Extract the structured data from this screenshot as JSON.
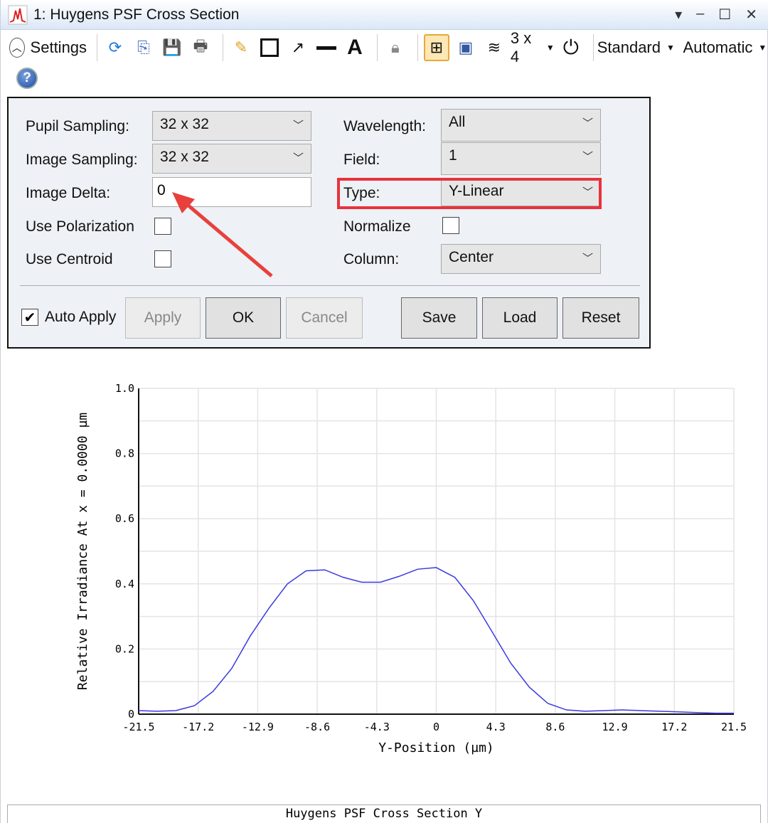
{
  "window": {
    "title": "1: Huygens PSF Cross Section",
    "controls": [
      "▾",
      "–",
      "☐",
      "✕"
    ]
  },
  "toolbar": {
    "settings_label": "Settings",
    "layout": "3 x 4",
    "standard": "Standard",
    "automatic": "Automatic"
  },
  "settings": {
    "pupil_sampling_label": "Pupil Sampling:",
    "pupil_sampling": "32 x 32",
    "image_sampling_label": "Image Sampling:",
    "image_sampling": "32 x 32",
    "image_delta_label": "Image Delta:",
    "image_delta": "0",
    "use_polarization_label": "Use Polarization",
    "use_centroid_label": "Use Centroid",
    "wavelength_label": "Wavelength:",
    "wavelength": "All",
    "field_label": "Field:",
    "field": "1",
    "type_label": "Type:",
    "type": "Y-Linear",
    "normalize_label": "Normalize",
    "column_label": "Column:",
    "column": "Center",
    "auto_apply_label": "Auto Apply",
    "apply": "Apply",
    "ok": "OK",
    "cancel": "Cancel",
    "save": "Save",
    "load": "Load",
    "reset": "Reset"
  },
  "chart_data": {
    "type": "line",
    "title": "Huygens PSF Cross Section Y",
    "xlabel": "Y-Position (µm)",
    "ylabel": "Relative Irradiance At x = 0.0000 µm",
    "xlim": [
      -21.5,
      21.5
    ],
    "ylim": [
      0,
      1.0
    ],
    "xticks": [
      "-21.5",
      "-17.2",
      "-12.9",
      "-8.6",
      "-4.3",
      "0",
      "4.3",
      "8.6",
      "12.9",
      "17.2",
      "21.5"
    ],
    "yticks": [
      "0",
      "0.2",
      "0.4",
      "0.6",
      "0.8",
      "1.0"
    ],
    "grid": true,
    "line_color": "#3a3ae0",
    "y": [
      0.011,
      0.009,
      0.011,
      0.026,
      0.07,
      0.14,
      0.24,
      0.325,
      0.4,
      0.44,
      0.443,
      0.42,
      0.405,
      0.405,
      0.423,
      0.445,
      0.45,
      0.42,
      0.348,
      0.253,
      0.157,
      0.083,
      0.033,
      0.013,
      0.009,
      0.011,
      0.013,
      0.011,
      0.009,
      0.007,
      0.005,
      0.003,
      0.003
    ]
  }
}
